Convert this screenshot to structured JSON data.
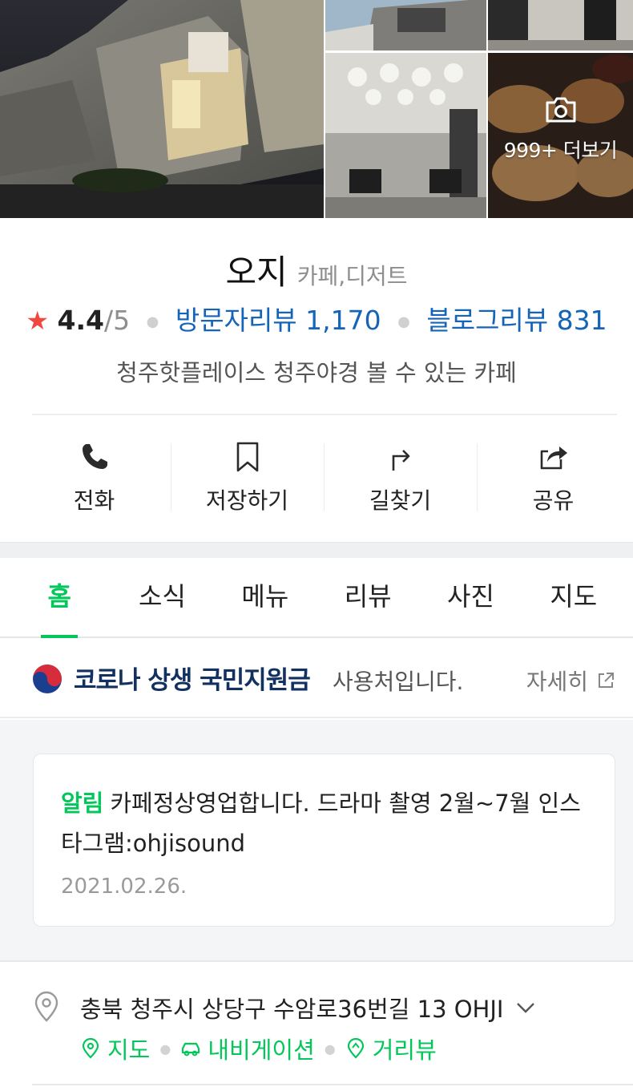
{
  "gallery": {
    "more_label": "999+ 더보기"
  },
  "place": {
    "name": "오지",
    "category": "카페,디저트",
    "rating_star": "★",
    "rating_score": "4.4",
    "rating_max": "/5",
    "visitor_review_label": "방문자리뷰 1,170",
    "blog_review_label": "블로그리뷰 831",
    "description": "청주핫플레이스 청주야경 볼 수 있는 카페"
  },
  "actions": {
    "call": "전화",
    "save": "저장하기",
    "directions": "길찾기",
    "share": "공유"
  },
  "tabs": [
    {
      "label": "홈"
    },
    {
      "label": "소식"
    },
    {
      "label": "메뉴"
    },
    {
      "label": "리뷰"
    },
    {
      "label": "사진"
    },
    {
      "label": "지도"
    }
  ],
  "support_banner": {
    "bold_text": "코로나 상생 국민지원금",
    "normal_text": "사용처입니다.",
    "detail_label": "자세히"
  },
  "notice": {
    "tag": "알림",
    "text": "카페정상영업합니다. 드라마 촬영 2월~7월 인스타그램:ohjisound",
    "date": "2021.02.26."
  },
  "address": {
    "text": "충북 청주시 상당구 수암로36번길 13 OHJI",
    "links": {
      "map": "지도",
      "navigation": "내비게이션",
      "street_view": "거리뷰"
    }
  },
  "colors": {
    "accent_green": "#03c75a",
    "link_blue": "#1464b8",
    "star_red": "#f2473f"
  }
}
